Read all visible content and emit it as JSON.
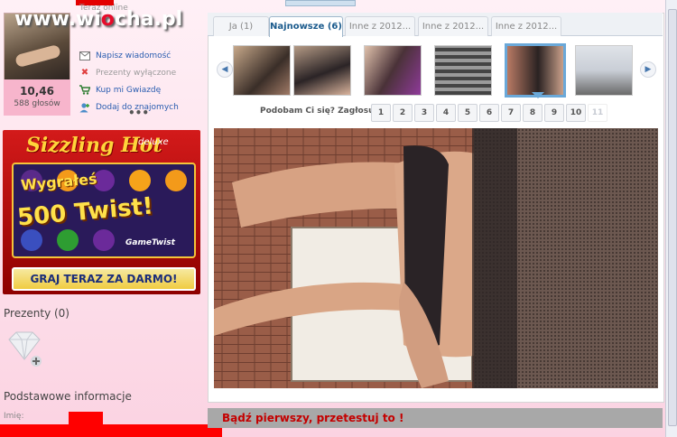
{
  "site": {
    "logo_pre": "www.wi",
    "logo_o": "o",
    "logo_post": "cha.pl"
  },
  "profile": {
    "online_text": "Teraz online",
    "score": "10,46",
    "votes": "588 głosów",
    "more": "•••",
    "actions": [
      {
        "label": "Napisz wiadomość",
        "icon": "envelope-icon",
        "disabled": false
      },
      {
        "label": "Prezenty wyłączone",
        "icon": "close-icon",
        "disabled": true
      },
      {
        "label": "Kup mi Gwiazdę",
        "icon": "cart-icon",
        "disabled": false
      },
      {
        "label": "Dodaj do znajomych",
        "icon": "add-friend-icon",
        "disabled": false
      }
    ]
  },
  "ad": {
    "title": "Sizzling Hot",
    "deluxe": "deluxe",
    "win": "Wygrałeś",
    "big": "500 Twist!",
    "brand": "GameTwist",
    "cta": "GRAJ TERAZ ZA DARMO!"
  },
  "gifts": {
    "title": "Prezenty (0)",
    "icon": "gift-diamond-icon"
  },
  "info": {
    "title": "Podstawowe informacje",
    "name_label": "Imię:"
  },
  "tabs": [
    {
      "label": "Ja (1)",
      "active": false
    },
    {
      "label": "Najnowsze (6)",
      "active": true
    },
    {
      "label": "Inne z 2012...",
      "active": false
    },
    {
      "label": "Inne z 2012...",
      "active": false
    },
    {
      "label": "Inne z 2012...",
      "active": false
    }
  ],
  "gallery": {
    "prev_icon": "chevron-left-icon",
    "next_icon": "chevron-right-icon",
    "selected_index": 4
  },
  "voting": {
    "label": "Podobam Ci się? Zagłosuj:",
    "options": [
      "1",
      "2",
      "3",
      "4",
      "5",
      "6",
      "7",
      "8",
      "9",
      "10",
      "11"
    ]
  },
  "comment": {
    "text": "Bądź pierwszy, przetestuj to !"
  },
  "colors": {
    "accent": "#1a5a8c",
    "pink": "#f7b5cc",
    "red": "#ff0000"
  }
}
